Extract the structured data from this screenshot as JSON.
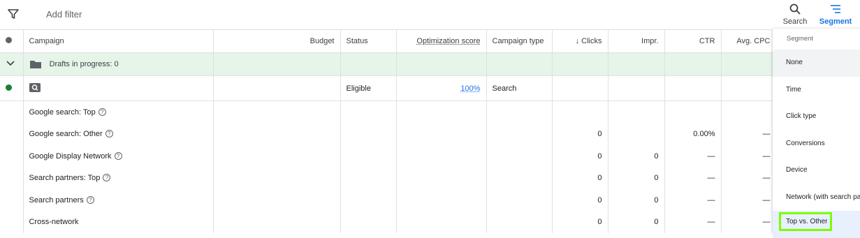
{
  "toolbar": {
    "add_filter_label": "Add filter",
    "search_label": "Search",
    "segment_label": "Segment",
    "accent_color": "#1a73e8"
  },
  "table": {
    "headers": {
      "campaign": "Campaign",
      "budget": "Budget",
      "status": "Status",
      "optimization_score": "Optimization score",
      "campaign_type": "Campaign type",
      "clicks": "↓ Clicks",
      "impr": "Impr.",
      "ctr": "CTR",
      "avg_cpc": "Avg. CPC"
    },
    "draft_row": {
      "label": "Drafts in progress: 0",
      "row_color": "#e6f4ea"
    },
    "campaign_row": {
      "status": "Eligible",
      "optimization_score": "100%",
      "campaign_type": "Search",
      "status_color": "#188038"
    },
    "segment_rows": [
      {
        "label": "Google search: Top",
        "help": "?",
        "clicks": "",
        "impr": "",
        "ctr": "",
        "avg_cpc": ""
      },
      {
        "label": "Google search: Other",
        "help": "?",
        "clicks": "0",
        "impr": "",
        "ctr": "0.00%",
        "avg_cpc": "—"
      },
      {
        "label": "Google Display Network",
        "help": "?",
        "clicks": "0",
        "impr": "0",
        "ctr": "—",
        "avg_cpc": "—"
      },
      {
        "label": "Search partners: Top",
        "help": "?",
        "clicks": "0",
        "impr": "0",
        "ctr": "—",
        "avg_cpc": "—"
      },
      {
        "label": "Search partners",
        "help": "?",
        "clicks": "0",
        "impr": "0",
        "ctr": "—",
        "avg_cpc": "—"
      },
      {
        "label": "Cross-network",
        "help": "",
        "clicks": "0",
        "impr": "0",
        "ctr": "—",
        "avg_cpc": "—"
      }
    ]
  },
  "segment_menu": {
    "header": "Segment",
    "items": [
      "None",
      "Time",
      "Click type",
      "Conversions",
      "Device",
      "Network (with search partners)",
      "Top vs. Other"
    ],
    "selected": "Top vs. Other",
    "highlight_color": "#7cfc00"
  }
}
